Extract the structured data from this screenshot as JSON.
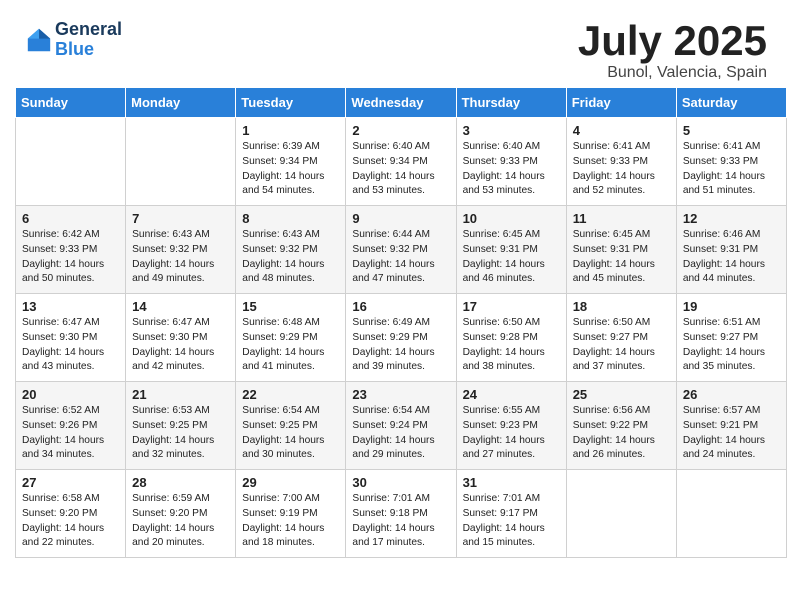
{
  "logo": {
    "general": "General",
    "blue": "Blue"
  },
  "title": {
    "month_year": "July 2025",
    "location": "Bunol, Valencia, Spain"
  },
  "weekdays": [
    "Sunday",
    "Monday",
    "Tuesday",
    "Wednesday",
    "Thursday",
    "Friday",
    "Saturday"
  ],
  "weeks": [
    [
      {
        "day": null
      },
      {
        "day": null
      },
      {
        "day": "1",
        "sunrise": "Sunrise: 6:39 AM",
        "sunset": "Sunset: 9:34 PM",
        "daylight": "Daylight: 14 hours and 54 minutes."
      },
      {
        "day": "2",
        "sunrise": "Sunrise: 6:40 AM",
        "sunset": "Sunset: 9:34 PM",
        "daylight": "Daylight: 14 hours and 53 minutes."
      },
      {
        "day": "3",
        "sunrise": "Sunrise: 6:40 AM",
        "sunset": "Sunset: 9:33 PM",
        "daylight": "Daylight: 14 hours and 53 minutes."
      },
      {
        "day": "4",
        "sunrise": "Sunrise: 6:41 AM",
        "sunset": "Sunset: 9:33 PM",
        "daylight": "Daylight: 14 hours and 52 minutes."
      },
      {
        "day": "5",
        "sunrise": "Sunrise: 6:41 AM",
        "sunset": "Sunset: 9:33 PM",
        "daylight": "Daylight: 14 hours and 51 minutes."
      }
    ],
    [
      {
        "day": "6",
        "sunrise": "Sunrise: 6:42 AM",
        "sunset": "Sunset: 9:33 PM",
        "daylight": "Daylight: 14 hours and 50 minutes."
      },
      {
        "day": "7",
        "sunrise": "Sunrise: 6:43 AM",
        "sunset": "Sunset: 9:32 PM",
        "daylight": "Daylight: 14 hours and 49 minutes."
      },
      {
        "day": "8",
        "sunrise": "Sunrise: 6:43 AM",
        "sunset": "Sunset: 9:32 PM",
        "daylight": "Daylight: 14 hours and 48 minutes."
      },
      {
        "day": "9",
        "sunrise": "Sunrise: 6:44 AM",
        "sunset": "Sunset: 9:32 PM",
        "daylight": "Daylight: 14 hours and 47 minutes."
      },
      {
        "day": "10",
        "sunrise": "Sunrise: 6:45 AM",
        "sunset": "Sunset: 9:31 PM",
        "daylight": "Daylight: 14 hours and 46 minutes."
      },
      {
        "day": "11",
        "sunrise": "Sunrise: 6:45 AM",
        "sunset": "Sunset: 9:31 PM",
        "daylight": "Daylight: 14 hours and 45 minutes."
      },
      {
        "day": "12",
        "sunrise": "Sunrise: 6:46 AM",
        "sunset": "Sunset: 9:31 PM",
        "daylight": "Daylight: 14 hours and 44 minutes."
      }
    ],
    [
      {
        "day": "13",
        "sunrise": "Sunrise: 6:47 AM",
        "sunset": "Sunset: 9:30 PM",
        "daylight": "Daylight: 14 hours and 43 minutes."
      },
      {
        "day": "14",
        "sunrise": "Sunrise: 6:47 AM",
        "sunset": "Sunset: 9:30 PM",
        "daylight": "Daylight: 14 hours and 42 minutes."
      },
      {
        "day": "15",
        "sunrise": "Sunrise: 6:48 AM",
        "sunset": "Sunset: 9:29 PM",
        "daylight": "Daylight: 14 hours and 41 minutes."
      },
      {
        "day": "16",
        "sunrise": "Sunrise: 6:49 AM",
        "sunset": "Sunset: 9:29 PM",
        "daylight": "Daylight: 14 hours and 39 minutes."
      },
      {
        "day": "17",
        "sunrise": "Sunrise: 6:50 AM",
        "sunset": "Sunset: 9:28 PM",
        "daylight": "Daylight: 14 hours and 38 minutes."
      },
      {
        "day": "18",
        "sunrise": "Sunrise: 6:50 AM",
        "sunset": "Sunset: 9:27 PM",
        "daylight": "Daylight: 14 hours and 37 minutes."
      },
      {
        "day": "19",
        "sunrise": "Sunrise: 6:51 AM",
        "sunset": "Sunset: 9:27 PM",
        "daylight": "Daylight: 14 hours and 35 minutes."
      }
    ],
    [
      {
        "day": "20",
        "sunrise": "Sunrise: 6:52 AM",
        "sunset": "Sunset: 9:26 PM",
        "daylight": "Daylight: 14 hours and 34 minutes."
      },
      {
        "day": "21",
        "sunrise": "Sunrise: 6:53 AM",
        "sunset": "Sunset: 9:25 PM",
        "daylight": "Daylight: 14 hours and 32 minutes."
      },
      {
        "day": "22",
        "sunrise": "Sunrise: 6:54 AM",
        "sunset": "Sunset: 9:25 PM",
        "daylight": "Daylight: 14 hours and 30 minutes."
      },
      {
        "day": "23",
        "sunrise": "Sunrise: 6:54 AM",
        "sunset": "Sunset: 9:24 PM",
        "daylight": "Daylight: 14 hours and 29 minutes."
      },
      {
        "day": "24",
        "sunrise": "Sunrise: 6:55 AM",
        "sunset": "Sunset: 9:23 PM",
        "daylight": "Daylight: 14 hours and 27 minutes."
      },
      {
        "day": "25",
        "sunrise": "Sunrise: 6:56 AM",
        "sunset": "Sunset: 9:22 PM",
        "daylight": "Daylight: 14 hours and 26 minutes."
      },
      {
        "day": "26",
        "sunrise": "Sunrise: 6:57 AM",
        "sunset": "Sunset: 9:21 PM",
        "daylight": "Daylight: 14 hours and 24 minutes."
      }
    ],
    [
      {
        "day": "27",
        "sunrise": "Sunrise: 6:58 AM",
        "sunset": "Sunset: 9:20 PM",
        "daylight": "Daylight: 14 hours and 22 minutes."
      },
      {
        "day": "28",
        "sunrise": "Sunrise: 6:59 AM",
        "sunset": "Sunset: 9:20 PM",
        "daylight": "Daylight: 14 hours and 20 minutes."
      },
      {
        "day": "29",
        "sunrise": "Sunrise: 7:00 AM",
        "sunset": "Sunset: 9:19 PM",
        "daylight": "Daylight: 14 hours and 18 minutes."
      },
      {
        "day": "30",
        "sunrise": "Sunrise: 7:01 AM",
        "sunset": "Sunset: 9:18 PM",
        "daylight": "Daylight: 14 hours and 17 minutes."
      },
      {
        "day": "31",
        "sunrise": "Sunrise: 7:01 AM",
        "sunset": "Sunset: 9:17 PM",
        "daylight": "Daylight: 14 hours and 15 minutes."
      },
      {
        "day": null
      },
      {
        "day": null
      }
    ]
  ]
}
